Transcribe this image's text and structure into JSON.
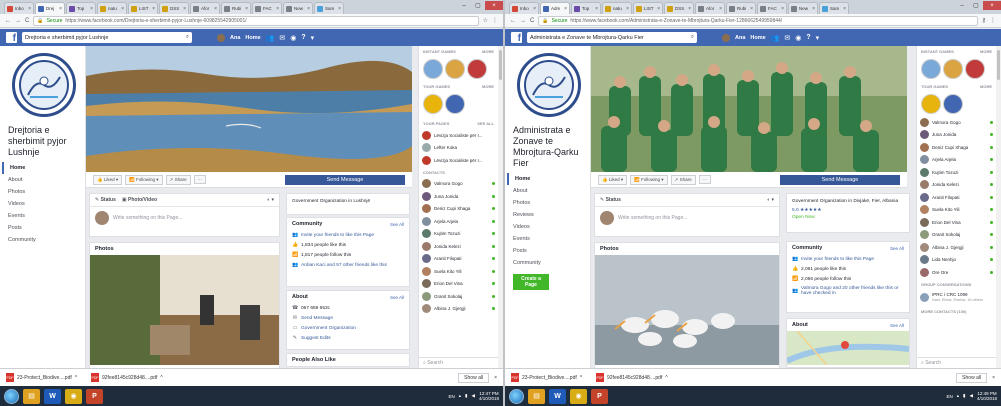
{
  "s1": {
    "tabs": [
      {
        "label": "Inbo",
        "color": "#d44638"
      },
      {
        "label": "Drej",
        "color": "#4267b2",
        "active": true
      },
      {
        "label": "Top",
        "color": "#6a4ca8"
      },
      {
        "label": "natu",
        "color": "#d0a010"
      },
      {
        "label": "LIST",
        "color": "#d0a010"
      },
      {
        "label": "DSS",
        "color": "#d0a010"
      },
      {
        "label": "Afor",
        "color": "#7a7f86"
      },
      {
        "label": "Rubi",
        "color": "#7a7f86"
      },
      {
        "label": "FAC",
        "color": "#7a7f86"
      },
      {
        "label": "New",
        "color": "#7a7f86"
      },
      {
        "label": "Sam",
        "color": "#4aa0d8"
      }
    ],
    "address": {
      "secure": "Secure",
      "url": "https://www.facebook.com/Drejtoria-e-sherbimit-pyjor-Lushnje-609825542905001/"
    },
    "fb_search": "Drejtoria e sherbimit pyjor Lushnje",
    "user": "Ana",
    "home": "Home",
    "page_name": "Drejtoria e sherbimit pyjor Lushnje",
    "logo_text": "Parku Kombëtar DIVJAKE-KARAVASTA",
    "nav": [
      "Home",
      "About",
      "Photos",
      "Videos",
      "Events",
      "Posts",
      "Community"
    ],
    "actions": {
      "liked": "Liked",
      "following": "Following",
      "share": "Share",
      "more": "···",
      "send": "Send Message"
    },
    "composer": {
      "status": "Status",
      "photo": "Photo/Video",
      "placeholder": "Write something on this Page..."
    },
    "photos_title": "Photos",
    "category": "Government Organization in Lushnjë",
    "community": {
      "title": "Community",
      "see": "See All",
      "rows": [
        {
          "icon": "👥",
          "text": "Invite your friends to like this Page",
          "link": true
        },
        {
          "icon": "👍",
          "text": "1,834 people like this"
        },
        {
          "icon": "📶",
          "text": "1,817 people follow this"
        },
        {
          "icon": "👥",
          "text": "Ardian Kaci and 57 other friends like this"
        }
      ]
    },
    "about": {
      "title": "About",
      "see": "See All",
      "rows": [
        {
          "icon": "📞",
          "text": "067 669 653c"
        },
        {
          "icon": "✉",
          "text": "Send Message",
          "link": true
        },
        {
          "icon": "▭",
          "text": "Government Organization",
          "link": true
        },
        {
          "icon": "✎",
          "text": "Suggest Edits",
          "link": true
        }
      ]
    },
    "people_also": "People Also Like",
    "right": {
      "instant": "INSTANT GAMES",
      "more": "MORE",
      "tour": "TOUR GAMES",
      "your_pages": "YOUR PAGES",
      "see_all": "SEE ALL",
      "pages": [
        "Lëvizja Socialiste për I...",
        "Lefter Koka",
        "Lëvizja Socialiste për I..."
      ],
      "contacts_label": "CONTACTS",
      "contacts": [
        "Valmora Gogo",
        "Juna Jonida",
        "Deniz Cupi Xhaga",
        "Arjela Arjela",
        "Kujtim Tozuzi",
        "Jonida Kelezi",
        "Aranit Filopati",
        "Suela Kito Yili",
        "Erion Del Vina",
        "Granit Sokolaj",
        "Albina J. Gjergji"
      ],
      "search": "Search"
    }
  },
  "s2": {
    "tabs": [
      {
        "label": "Inbo",
        "color": "#d44638"
      },
      {
        "label": "Adm",
        "color": "#4267b2",
        "active": true
      },
      {
        "label": "Top",
        "color": "#6a4ca8"
      },
      {
        "label": "natu",
        "color": "#d0a010"
      },
      {
        "label": "LIST",
        "color": "#d0a010"
      },
      {
        "label": "DSS",
        "color": "#d0a010"
      },
      {
        "label": "Afor",
        "color": "#7a7f86"
      },
      {
        "label": "Rubi",
        "color": "#7a7f86"
      },
      {
        "label": "FAC",
        "color": "#7a7f86"
      },
      {
        "label": "New",
        "color": "#7a7f86"
      },
      {
        "label": "Sam",
        "color": "#4aa0d8"
      }
    ],
    "address": {
      "secure": "Secure",
      "url": "https://www.facebook.com/Administrata-e-Zonave-te-Mbrojtura-Qarku-Fier-1286662549959844/"
    },
    "fb_search": "Administrata e Zonave te Mbrojtura-Qarku Fier",
    "user": "Ana",
    "home": "Home",
    "page_name": "Administrata e Zonave te Mbrojtura-Qarku Fier",
    "logo_text": "Parku Kombëtar DIVJAKE-KARAVASTA",
    "nav": [
      "Home",
      "About",
      "Photos",
      "Reviews",
      "Videos",
      "Events",
      "Posts",
      "Community"
    ],
    "cta": "Create a Page",
    "actions": {
      "liked": "Liked",
      "following": "Following",
      "share": "Share",
      "more": "···",
      "send": "Send Message"
    },
    "composer": {
      "status": "Status",
      "placeholder": "Write something on this Page..."
    },
    "photos_title": "Photos",
    "category": "Government Organization in Divjakë, Fier, Albania",
    "rating": "5.0 ★★★★★",
    "open_now": "Open Now",
    "community": {
      "title": "Community",
      "see": "See All",
      "rows": [
        {
          "icon": "👥",
          "text": "Invite your friends to like this Page",
          "link": true
        },
        {
          "icon": "👍",
          "text": "2,061 people like this"
        },
        {
          "icon": "📶",
          "text": "2,056 people follow this"
        },
        {
          "icon": "👥",
          "text": "Valmora Gogo and 20 other friends like this or have checked in"
        }
      ]
    },
    "about": {
      "title": "About",
      "see": "See All"
    },
    "right": {
      "instant": "INSTANT GAMES",
      "more": "MORE",
      "tour": "TOUR GAMES",
      "contacts": [
        "Valmora Gogo",
        "Juna Jonida",
        "Deniz Cupi Xhaga",
        "Arjela Arjela",
        "Kujtim Tozuzi",
        "Jonida Kelezi",
        "Aranit Filopati",
        "Suela Kito Yili",
        "Erion Del Vina",
        "Granit Sokolaj",
        "Albina J. Gjergji",
        "Lida Nenhjo",
        "Ore Ore"
      ],
      "group_conv": "GROUP CONVERSATIONS",
      "group": "IPRC / CRC 1099",
      "group_sub": "Noel, Elvira, Enelsa, 16 others",
      "more_contacts": "MORE CONTACTS (100)",
      "search": "Search"
    }
  },
  "downloads": [
    "23-Protect_Biodive....pdf",
    "92fee8145c928d48....pdf"
  ],
  "show_all": "Show all",
  "taskbar": {
    "lang": "EN",
    "time1": "12:47 PM",
    "date1": "4/10/2018",
    "time2": "12:49 PM",
    "date2": "4/10/2018"
  }
}
